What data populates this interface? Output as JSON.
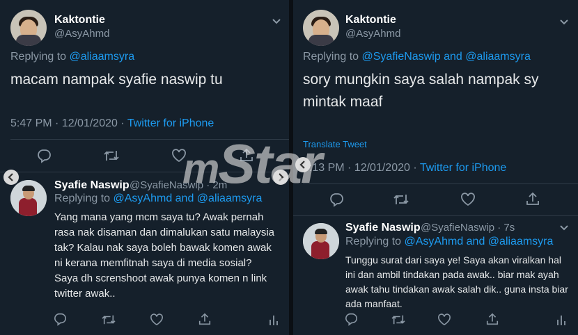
{
  "left": {
    "main_tweet": {
      "display_name": "Kaktontie",
      "handle": "@AsyAhmd",
      "replying_label": "Replying to",
      "replying_to": "@aliaamsyra",
      "text": "macam nampak syafie naswip tu",
      "timestamp": "5:47 PM · 12/01/2020 ·",
      "source": "Twitter for iPhone"
    },
    "reply": {
      "display_name": "Syafie Naswip",
      "handle_time": "@SyafieNaswip · 2m",
      "replying_label": "Replying to",
      "replying_to": "@AsyAhmd and @aliaamsyra",
      "text": "Yang mana yang mcm saya tu? Awak pernah rasa nak disaman dan dimalukan satu malaysia tak? Kalau nak saya boleh bawak komen awak ni kerana memfitnah saya di media sosial?\nSaya dh screnshoot awak punya komen n link twitter awak.."
    }
  },
  "right": {
    "main_tweet": {
      "display_name": "Kaktontie",
      "handle": "@AsyAhmd",
      "replying_label": "Replying to",
      "replying_to": "@SyafieNaswip and @aliaamsyra",
      "text": "sory mungkin saya salah nampak sy mintak maaf",
      "translate": "Translate Tweet",
      "timestamp": "5:13 PM · 12/01/2020 ·",
      "source": "Twitter for iPhone"
    },
    "reply": {
      "display_name": "Syafie Naswip",
      "handle_time": "@SyafieNaswip · 7s",
      "replying_label": "Replying to",
      "replying_to": "@AsyAhmd and @aliaamsyra",
      "text": "Tunggu surat dari saya ye! Saya akan viralkan hal ini dan ambil tindakan pada awak.. biar mak ayah awak tahu tindakan awak salah dik.. guna insta biar ada manfaat."
    }
  },
  "watermark": {
    "m": "m",
    "word": "Star"
  },
  "icons": [
    "chevron-down-icon",
    "reply-icon",
    "retweet-icon",
    "like-icon",
    "share-icon",
    "analytics-icon",
    "arrow-left-icon",
    "arrow-right-icon"
  ],
  "colors": {
    "background": "#15202b",
    "link": "#1d9bf0",
    "secondary_text": "#8b98a5",
    "primary_text": "#e7e9ea"
  }
}
